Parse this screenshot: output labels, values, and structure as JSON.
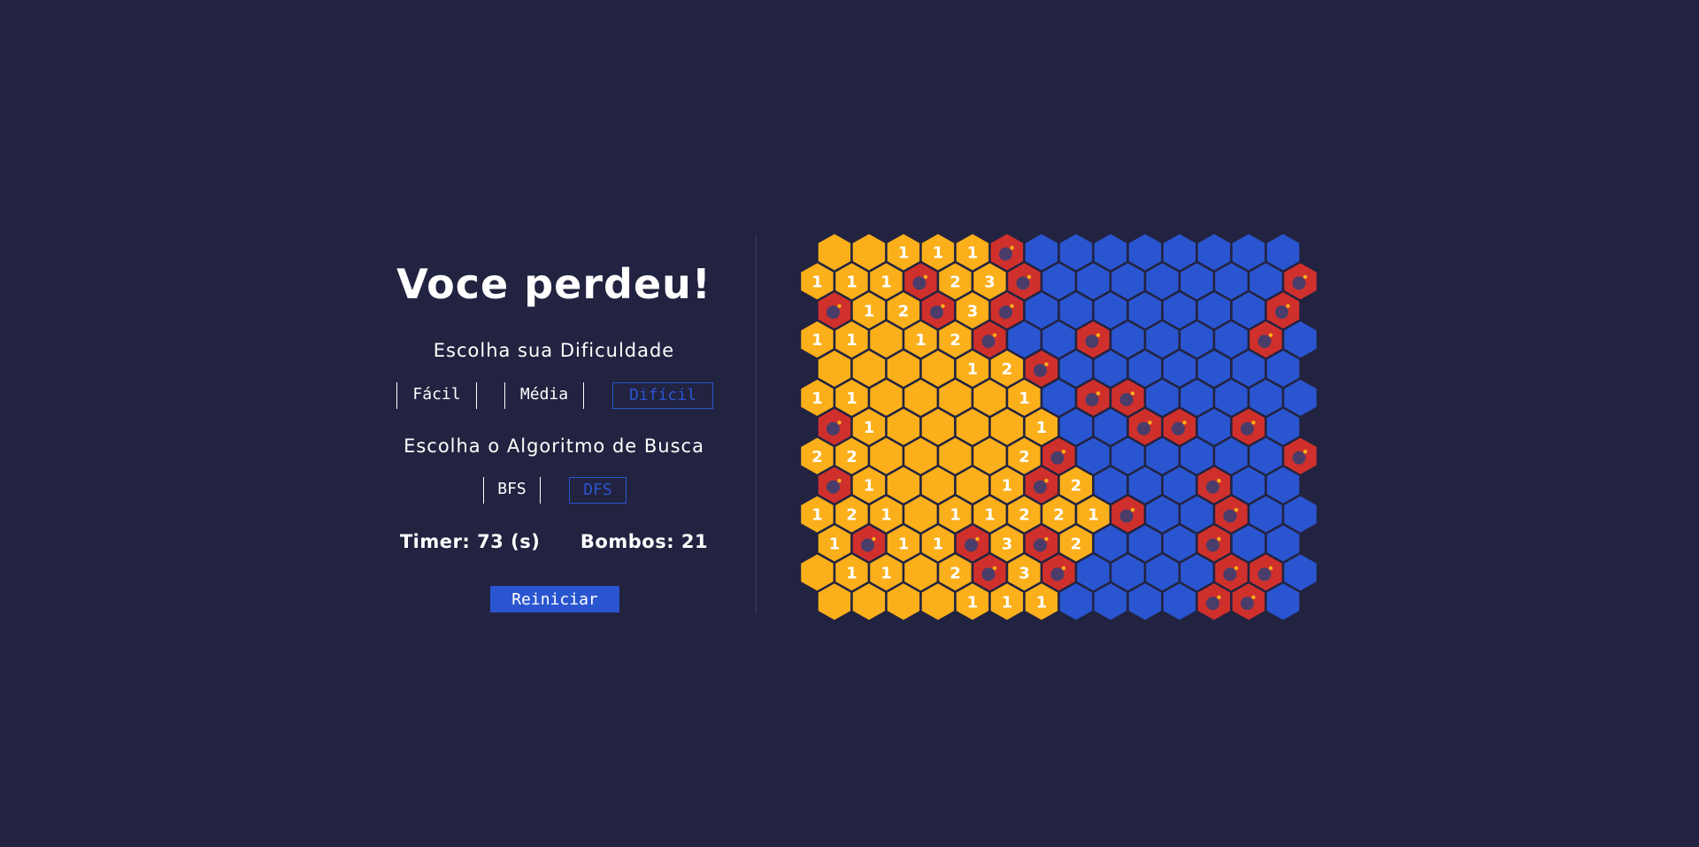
{
  "status": {
    "title": "Voce perdeu!"
  },
  "difficulty": {
    "heading": "Escolha sua Dificuldade",
    "options": [
      "Fácil",
      "Média",
      "Difícil"
    ],
    "selected": "Difícil"
  },
  "algorithm": {
    "heading": "Escolha o Algoritmo de Busca",
    "options": [
      "BFS",
      "DFS"
    ],
    "selected": "DFS"
  },
  "stats": {
    "timer_label": "Timer:",
    "timer_value": "73 (s)",
    "bombs_label": "Bombos:",
    "bombs_value": "21"
  },
  "restart_label": "Reiniciar",
  "colors": {
    "background": "#222340",
    "accent": "#2a55d0",
    "revealed": "#fbaf1a",
    "hidden": "#2a55d0",
    "mine": "#d0302c",
    "bomb": "#4a3d6a"
  },
  "board": {
    "cols": 15,
    "rows": [
      [
        "",
        "",
        "1",
        "1",
        "1",
        "B",
        "H",
        "H",
        "H",
        "H",
        "H",
        "H",
        "H",
        "H",
        null
      ],
      [
        "1",
        "1",
        "1",
        "B",
        "2",
        "3",
        "B",
        "H",
        "H",
        "H",
        "H",
        "H",
        "H",
        "H",
        "B"
      ],
      [
        "B",
        "1",
        "2",
        "B",
        "3",
        "B",
        "H",
        "H",
        "H",
        "H",
        "H",
        "H",
        "H",
        "B",
        null
      ],
      [
        "1",
        "1",
        "",
        "1",
        "2",
        "B",
        "H",
        "H",
        "B",
        "H",
        "H",
        "H",
        "H",
        "B",
        "H"
      ],
      [
        "",
        "",
        "",
        "",
        "1",
        "2",
        "B",
        "H",
        "H",
        "H",
        "H",
        "H",
        "H",
        "H",
        null
      ],
      [
        "1",
        "1",
        "",
        "",
        "",
        "",
        "1",
        "H",
        "B",
        "B",
        "H",
        "H",
        "H",
        "H",
        "H"
      ],
      [
        "B",
        "1",
        "",
        "",
        "",
        "",
        "1",
        "H",
        "H",
        "B",
        "B",
        "H",
        "B",
        "H",
        null
      ],
      [
        "2",
        "2",
        "",
        "",
        "",
        "",
        "2",
        "B",
        "H",
        "H",
        "H",
        "H",
        "H",
        "H",
        "B"
      ],
      [
        "B",
        "1",
        "",
        "",
        "",
        "1",
        "B",
        "2",
        "H",
        "H",
        "H",
        "B",
        "H",
        "H",
        null
      ],
      [
        "1",
        "2",
        "1",
        "",
        "1",
        "1",
        "2",
        "2",
        "1",
        "B",
        "H",
        "H",
        "B",
        "H",
        "H"
      ],
      [
        "1",
        "B",
        "1",
        "1",
        "B",
        "3",
        "B",
        "2",
        "H",
        "H",
        "H",
        "B",
        "H",
        "H",
        null
      ],
      [
        "",
        "1",
        "1",
        "",
        "2",
        "B",
        "3",
        "B",
        "H",
        "H",
        "H",
        "H",
        "B",
        "B",
        "H"
      ],
      [
        "",
        "",
        "",
        "",
        "1",
        "1",
        "1",
        "H",
        "H",
        "H",
        "H",
        "B",
        "B",
        "H",
        null
      ]
    ]
  }
}
